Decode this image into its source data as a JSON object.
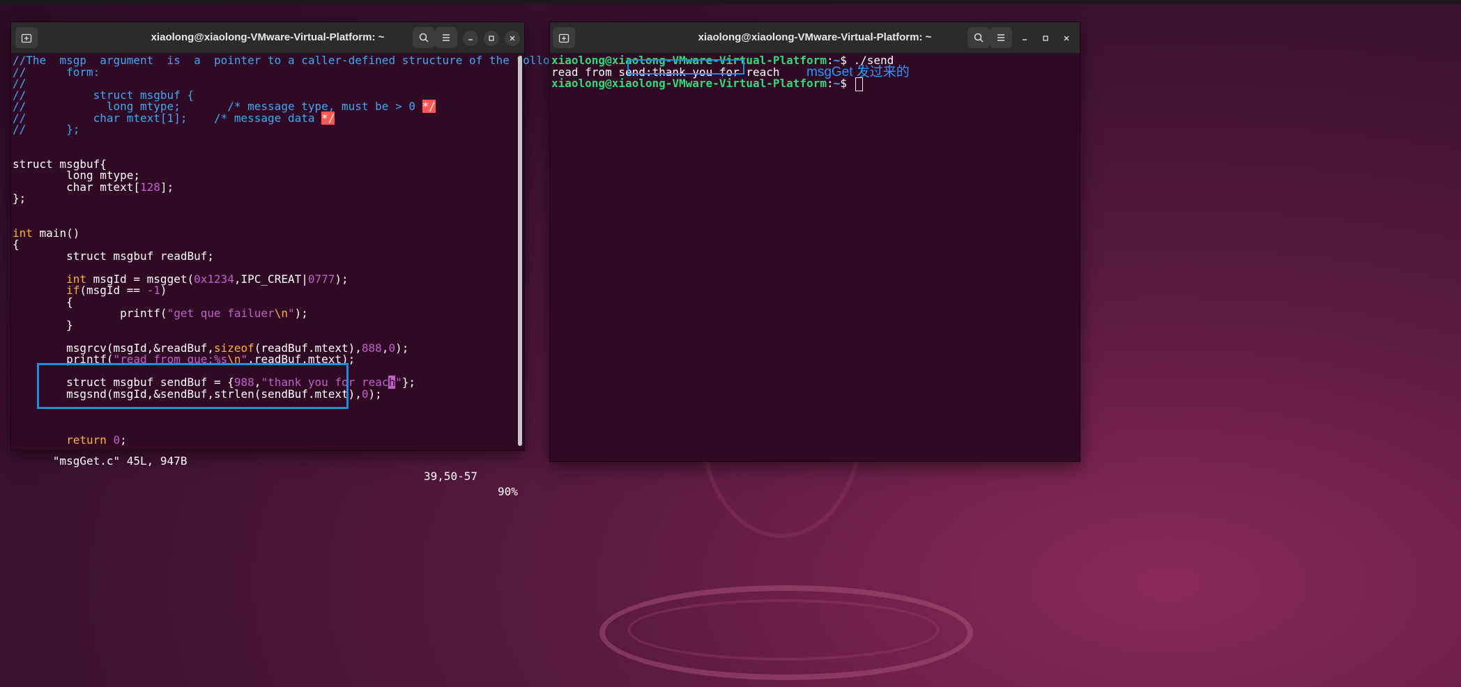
{
  "left_window": {
    "title": "xiaolong@xiaolong-VMware-Virtual-Platform: ~",
    "status_file": "\"msgGet.c\" 45L, 947B",
    "status_pos": "39,50-57",
    "status_pct": "90%",
    "code": {
      "l1": "//The  msgp  argument  is  a  pointer to a caller-defined structure of the following general",
      "l2": "//      form:",
      "l3": "//",
      "l4": "//          struct msgbuf {",
      "l5a": "//            long mtype;       /* message type, must be > 0 ",
      "l5b": "*/",
      "l6a": "//          char mtext[1];    /* message data ",
      "l6b": "*/",
      "l7": "//      };",
      "l10": "struct msgbuf{",
      "l11": "        long mtype;",
      "l12a": "        char mtext[",
      "l12n": "128",
      "l12c": "];",
      "l13": "};",
      "l16a": "int",
      "l16b": " main()",
      "l17": "{",
      "l18": "        struct msgbuf readBuf;",
      "l20a": "        int",
      "l20b": " msgId = msgget(",
      "l20n1": "0x1234",
      "l20c": ",IPC_CREAT|",
      "l20n2": "0",
      "l20n3": "777",
      "l20d": ");",
      "l21a": "        if",
      "l21b": "(msgId == ",
      "l21n": "-1",
      "l21c": ")",
      "l22": "        {",
      "l23a": "                printf(",
      "l23s": "\"get que failuer",
      "l23e": "\\n",
      "l23s2": "\"",
      "l23c": ");",
      "l24": "        }",
      "l26a": "        msgrcv(msgId,&readBuf,",
      "l26k": "sizeof",
      "l26b": "(readBuf.mtext),",
      "l26n1": "888",
      "l26c": ",",
      "l26n2": "0",
      "l26d": ");",
      "l27a": "        printf(",
      "l27s": "\"read from que:%s",
      "l27e": "\\n",
      "l27s2": "\"",
      "l27c": ",readBuf.mtext);",
      "l29a": "        struct msgbuf sendBuf = {",
      "l29n": "988",
      "l29c": ",",
      "l29s": "\"thank you for reac",
      "l29cur": "h",
      "l29s2": "\"",
      "l29d": "};",
      "l30a": "        msgsnd(msgId,&sendBuf,strlen(sendBuf.mtext),",
      "l30n": "0",
      "l30d": ");",
      "l33a": "        return ",
      "l33n": "0",
      "l33c": ";"
    }
  },
  "right_window": {
    "title": "xiaolong@xiaolong-VMware-Virtual-Platform: ~",
    "prompt_user": "xiaolong@xiaolong-VMware-Virtual-Platform",
    "prompt_sep": ":",
    "prompt_path": "~",
    "prompt_dollar": "$ ",
    "cmd1": "./send",
    "out_prefix": "read from send:",
    "out_value": "thank you for reach",
    "annotation": "msgGet 发过来的"
  },
  "colors": {
    "terminal_bg": "#300a24",
    "comment": "#3fa9f5",
    "number_string": "#c061cb",
    "keyword": "#fcb13a",
    "prompt_user": "#33da7a",
    "highlight_box": "#1b8fe0"
  },
  "icons": [
    "new-tab-icon",
    "search-icon",
    "menu-icon",
    "minimize-icon",
    "maximize-icon",
    "close-icon"
  ]
}
